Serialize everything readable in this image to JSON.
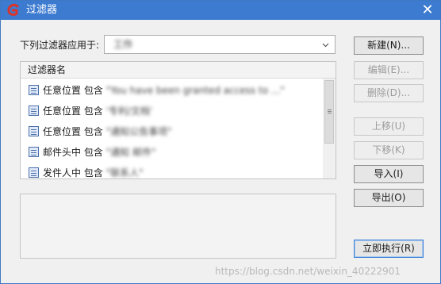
{
  "window": {
    "title": "过滤器",
    "close_glyph": "✕"
  },
  "apply": {
    "label": "下列过滤器应用于:",
    "selected_value": "工作"
  },
  "filter_list": {
    "header": "过滤器名",
    "rows": [
      {
        "prefix": "任意位置 包含 ",
        "value": "\"You have been granted access to ...\""
      },
      {
        "prefix": "任意位置 包含 ",
        "value": "'专利/文档'"
      },
      {
        "prefix": "任意位置 包含 ",
        "value": "\"通知公告事项\""
      },
      {
        "prefix": "邮件头中 包含 ",
        "value": "\"通知 邮件\""
      },
      {
        "prefix": "发件人中 包含 ",
        "value": "\"联系人\""
      }
    ]
  },
  "buttons": {
    "new": "新建(N)...",
    "edit": "编辑(E)...",
    "delete": "删除(D)...",
    "move_up": "上移(U)",
    "move_down": "下移(K)",
    "import": "导入(I)",
    "export": "导出(O)",
    "run_now": "立即执行(R)"
  },
  "watermark": "https://blog.csdn.net/weixin_40222901",
  "colors": {
    "titlebar": "#3d7bd0",
    "app_icon": "#d9342b",
    "disabled_text": "#9c9c9c"
  },
  "icons": {
    "app": "app-logo-icon",
    "close": "close-icon",
    "dropdown": "chevron-down-icon",
    "filter_row": "filter-rule-icon"
  }
}
